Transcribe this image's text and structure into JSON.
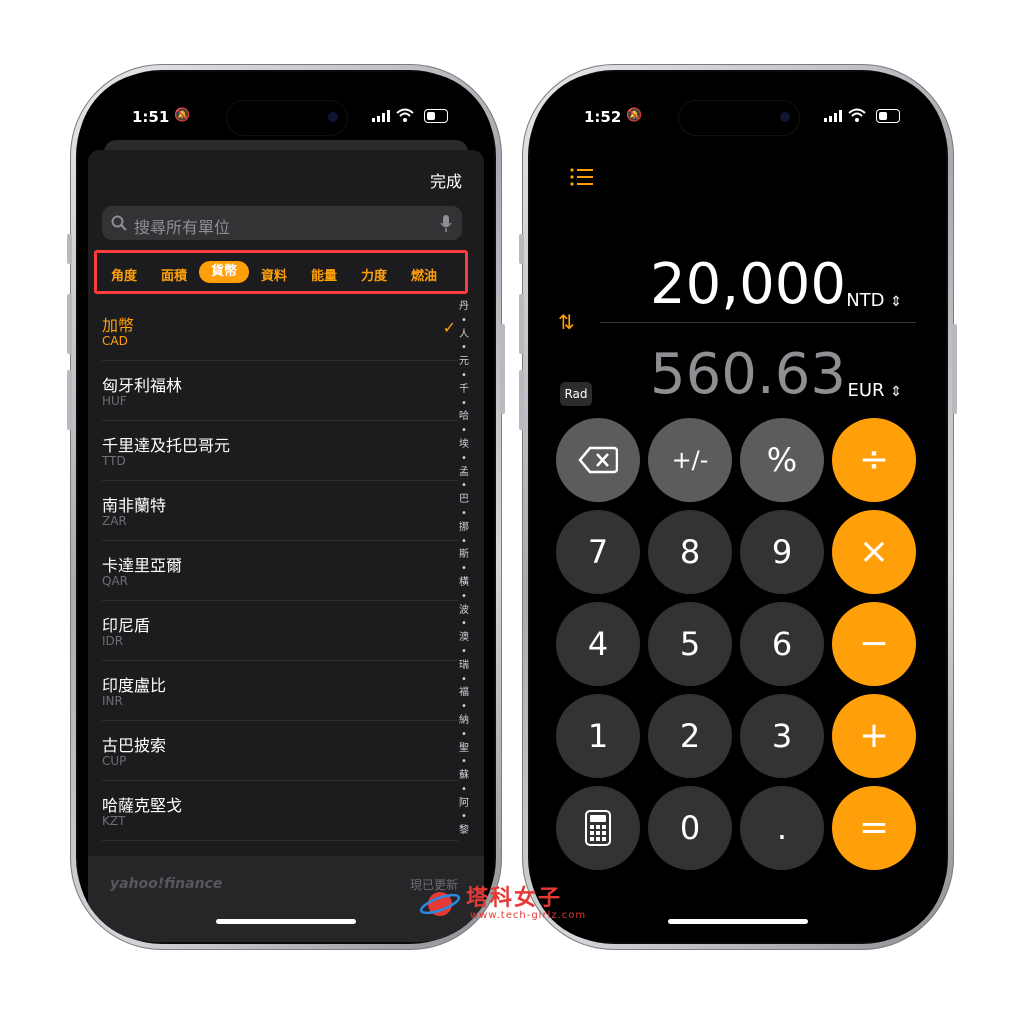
{
  "left_phone": {
    "status_time": "1:51",
    "done_label": "完成",
    "search_placeholder": "搜尋所有單位",
    "categories": [
      "角度",
      "面積",
      "貨幣",
      "資料",
      "能量",
      "力度",
      "燃油"
    ],
    "selected_category": "貨幣",
    "currencies": [
      {
        "name": "加幣",
        "code": "CAD",
        "selected": true
      },
      {
        "name": "匈牙利福林",
        "code": "HUF"
      },
      {
        "name": "千里達及托巴哥元",
        "code": "TTD"
      },
      {
        "name": "南非蘭特",
        "code": "ZAR"
      },
      {
        "name": "卡達里亞爾",
        "code": "QAR"
      },
      {
        "name": "印尼盾",
        "code": "IDR"
      },
      {
        "name": "印度盧比",
        "code": "INR"
      },
      {
        "name": "古巴披索",
        "code": "CUP"
      },
      {
        "name": "哈薩克堅戈",
        "code": "KZT"
      }
    ],
    "index_letters": [
      "丹",
      "•",
      "人",
      "•",
      "元",
      "•",
      "千",
      "•",
      "哈",
      "•",
      "埃",
      "•",
      "孟",
      "•",
      "巴",
      "•",
      "挪",
      "•",
      "斯",
      "•",
      "橫",
      "•",
      "波",
      "•",
      "澳",
      "•",
      "瑞",
      "•",
      "福",
      "•",
      "納",
      "•",
      "聖",
      "•",
      "蘇",
      "•",
      "阿",
      "•",
      "黎"
    ],
    "footer_brand": "yahoo!finance",
    "footer_status": "現已更新"
  },
  "right_phone": {
    "status_time": "1:52",
    "primary_value": "20,000",
    "primary_unit": "NTD",
    "secondary_value": "560.63",
    "secondary_unit": "EUR",
    "mode_label": "Rad",
    "keys": [
      [
        "⌫",
        "+/-",
        "%",
        "÷"
      ],
      [
        "7",
        "8",
        "9",
        "×"
      ],
      [
        "4",
        "5",
        "6",
        "−"
      ],
      [
        "1",
        "2",
        "3",
        "+"
      ],
      [
        "calc",
        "0",
        ".",
        "="
      ]
    ]
  },
  "watermark": {
    "title": "塔科女子",
    "url": "www.tech-girlz.com"
  },
  "colors": {
    "accent": "#ff9f0a",
    "highlight_box": "#ff3b3b",
    "sheet_bg": "#1c1c1e"
  }
}
